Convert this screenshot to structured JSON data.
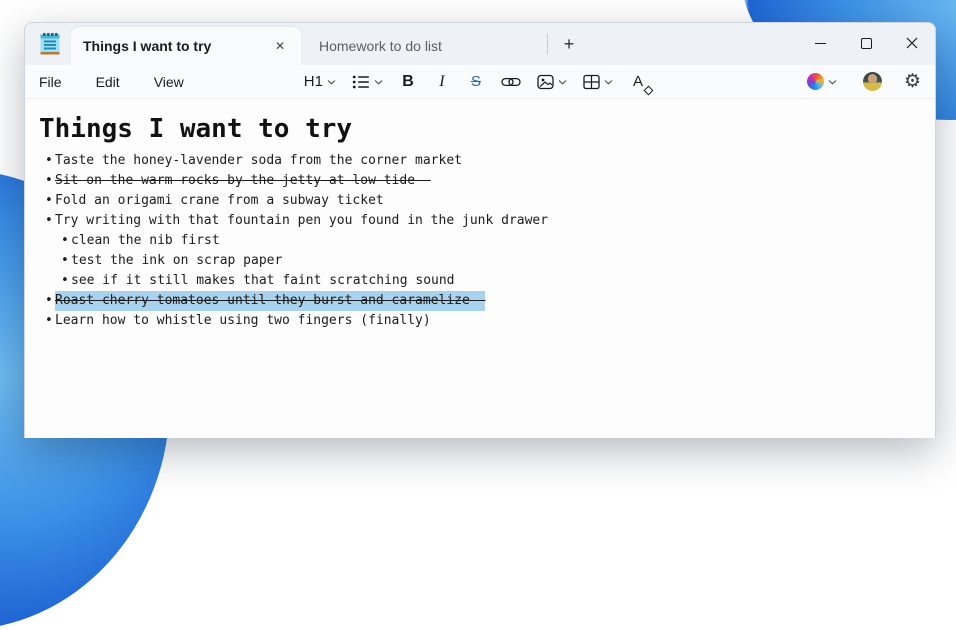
{
  "colors": {
    "selection": "#a9d2ee",
    "accent-strike": "#2b66b8",
    "wallpaper-blue": "#2f84e2",
    "titlebar": "#eef2f7",
    "active-tab": "#fafbfd"
  },
  "window": {
    "tabs": [
      {
        "label": "Things I want to try",
        "active": true
      },
      {
        "label": "Homework to do list",
        "active": false
      }
    ],
    "tab_close_glyph": "✕",
    "new_tab_glyph": "+"
  },
  "menus": {
    "file": "File",
    "edit": "Edit",
    "view": "View"
  },
  "toolbar": {
    "style_label": "H1",
    "bold_label": "B",
    "italic_label": "I",
    "strikethrough_label": "S",
    "clear_format_letter": "A",
    "gear_glyph": "⚙"
  },
  "document": {
    "title": "Things I want to try",
    "items": [
      {
        "level": 1,
        "text": "Taste the honey-lavender soda from the corner market"
      },
      {
        "level": 1,
        "text": "Sit on the warm rocks by the jetty at low tide",
        "strikethrough": true
      },
      {
        "level": 1,
        "text": "Fold an origami crane from a subway ticket"
      },
      {
        "level": 1,
        "text": "Try writing with that fountain pen you found in the junk drawer"
      },
      {
        "level": 2,
        "text": "clean the nib first"
      },
      {
        "level": 2,
        "text": "test the ink on scrap paper"
      },
      {
        "level": 2,
        "text": "see if it still makes that faint scratching sound"
      },
      {
        "level": 1,
        "text": "Roast cherry tomatoes until they burst and caramelize",
        "strikethrough": true,
        "selected": true
      },
      {
        "level": 1,
        "text": "Learn how to whistle using two fingers (finally)"
      }
    ]
  }
}
